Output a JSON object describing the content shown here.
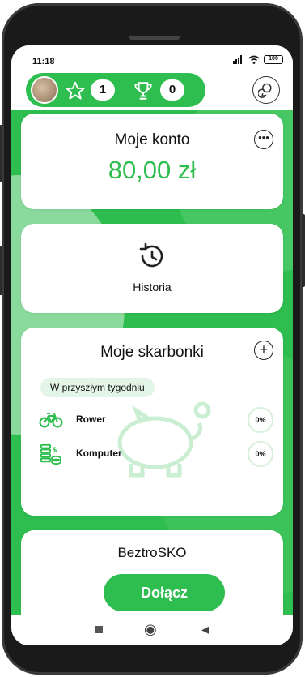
{
  "status_bar": {
    "time": "11:18",
    "battery": "100"
  },
  "profile": {
    "stars": "1",
    "trophies": "0"
  },
  "account": {
    "title": "Moje konto",
    "balance": "80,00 zł"
  },
  "history": {
    "label": "Historia"
  },
  "piggybanks": {
    "title": "Moje skarbonki",
    "period_chip": "W przyszłym tygodniu",
    "goals": [
      {
        "label": "Rower",
        "percent": "0%",
        "icon": "bike-icon"
      },
      {
        "label": "Komputer",
        "percent": "0%",
        "icon": "money-icon"
      }
    ]
  },
  "promo": {
    "title": "BeztroSKO",
    "button": "Dołącz"
  },
  "nav": {
    "home": "◉",
    "back": "◂"
  },
  "colors": {
    "accent": "#2ebd4f",
    "chip": "#e3f5e6"
  }
}
